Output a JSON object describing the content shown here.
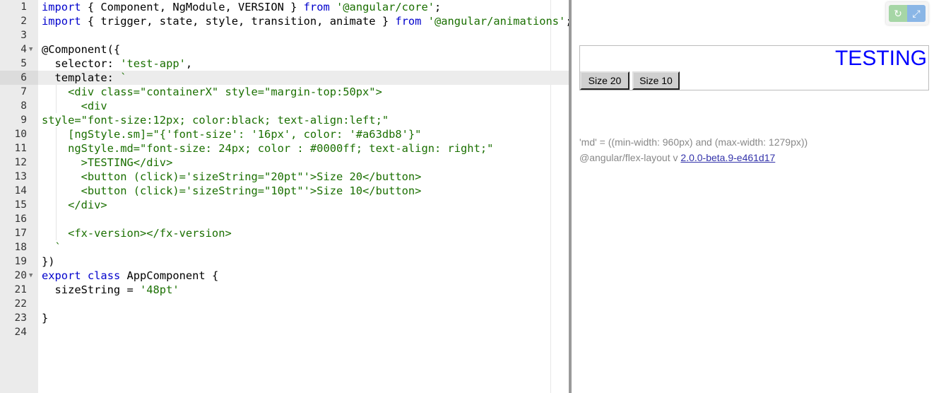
{
  "editor": {
    "lines": [
      {
        "n": "1",
        "fold": false,
        "html": "<span class=\"kw\">import</span> { Component, NgModule, VERSION } <span class=\"kw\">from</span> <span class=\"str\">'@angular/core'</span>;"
      },
      {
        "n": "2",
        "fold": false,
        "html": "<span class=\"kw\">import</span> { trigger, state, style, transition, animate } <span class=\"kw\">from</span> <span class=\"str\">'@angular/animations'</span>;"
      },
      {
        "n": "3",
        "fold": false,
        "html": ""
      },
      {
        "n": "4",
        "fold": true,
        "html": "@Component({"
      },
      {
        "n": "5",
        "fold": false,
        "html": "  selector: <span class=\"str\">'test-app'</span>,"
      },
      {
        "n": "6",
        "fold": false,
        "active": true,
        "html": "  template: <span class=\"str\">`</span>"
      },
      {
        "n": "7",
        "fold": false,
        "guide": true,
        "html": "    <span class=\"tag\">&lt;div class=\"containerX\" style=\"margin-top:50px\"&gt;</span>"
      },
      {
        "n": "8",
        "fold": false,
        "guide": true,
        "html": "      <span class=\"tag\">&lt;div</span>"
      },
      {
        "n": "9",
        "fold": false,
        "html": "<span class=\"tag\">style=\"font-size:12px; color:black; text-align:left;\"</span>"
      },
      {
        "n": "10",
        "fold": false,
        "guide": true,
        "html": "    <span class=\"tag\">[ngStyle.sm]=\"{'font-size': '16px', color: '#a63db8'}\"</span>"
      },
      {
        "n": "11",
        "fold": false,
        "guide": true,
        "html": "    <span class=\"tag\">ngStyle.md=\"font-size: 24px; color : #0000ff; text-align: right;\"</span>"
      },
      {
        "n": "12",
        "fold": false,
        "guide": true,
        "html": "      <span class=\"tag\">&gt;TESTING&lt;/div&gt;</span>"
      },
      {
        "n": "13",
        "fold": false,
        "guide": true,
        "html": "      <span class=\"tag\">&lt;button (click)='sizeString=\"20pt\"'&gt;Size 20&lt;/button&gt;</span>"
      },
      {
        "n": "14",
        "fold": false,
        "guide": true,
        "html": "      <span class=\"tag\">&lt;button (click)='sizeString=\"10pt\"'&gt;Size 10&lt;/button&gt;</span>"
      },
      {
        "n": "15",
        "fold": false,
        "guide": true,
        "html": "    <span class=\"tag\">&lt;/div&gt;</span>"
      },
      {
        "n": "16",
        "fold": false,
        "guide": true,
        "html": ""
      },
      {
        "n": "17",
        "fold": false,
        "guide": true,
        "html": "    <span class=\"tag\">&lt;fx-version&gt;&lt;/fx-version&gt;</span>"
      },
      {
        "n": "18",
        "fold": false,
        "html": "  <span class=\"str\">`</span>"
      },
      {
        "n": "19",
        "fold": false,
        "html": "})"
      },
      {
        "n": "20",
        "fold": true,
        "html": "<span class=\"kw\">export</span> <span class=\"kw\">class</span> AppComponent {"
      },
      {
        "n": "21",
        "fold": false,
        "html": "  sizeString = <span class=\"str\">'48pt'</span>"
      },
      {
        "n": "22",
        "fold": false,
        "html": ""
      },
      {
        "n": "23",
        "fold": false,
        "html": "}"
      },
      {
        "n": "24",
        "fold": false,
        "html": ""
      }
    ]
  },
  "preview": {
    "toolbar": {
      "refresh_icon": "↻",
      "expand_icon": "⤢"
    },
    "testing_text": "TESTING",
    "buttons": {
      "size20": "Size 20",
      "size10": "Size 10"
    },
    "mq_text": "'md' = ((min-width: 960px) and (max-width: 1279px))",
    "version_prefix": "@angular/flex-layout  v",
    "version_link": "2.0.0-beta.9-e461d17"
  },
  "colors": {
    "testing": "#0000ff",
    "keyword": "#0000cc",
    "string": "#1a6f00"
  }
}
